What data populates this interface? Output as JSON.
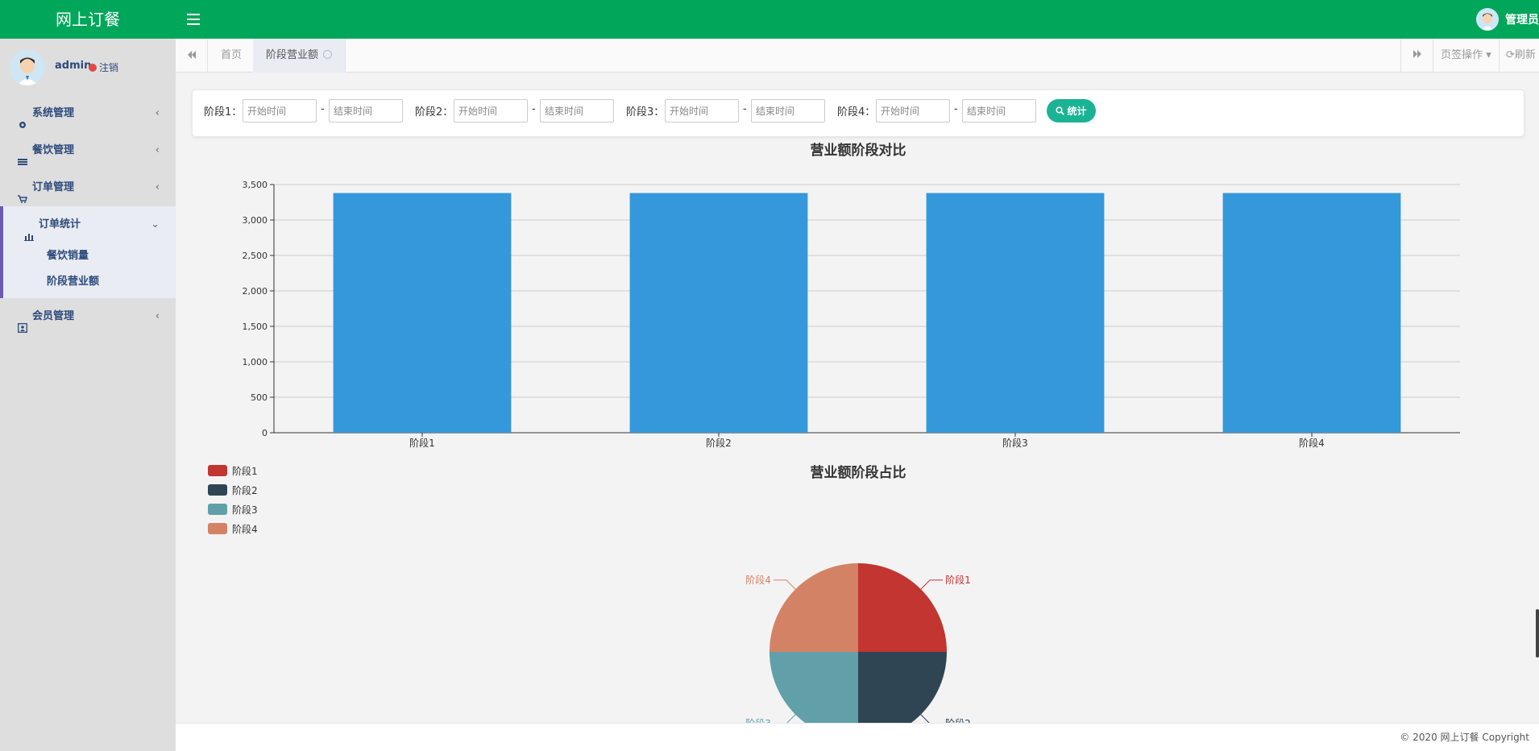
{
  "app": {
    "title": "网上订餐",
    "admin_label": "管理员"
  },
  "user": {
    "name": "admin",
    "logout": "注销"
  },
  "sidebar": {
    "items": [
      {
        "label": "系统管理",
        "icon": "gear-icon"
      },
      {
        "label": "餐饮管理",
        "icon": "list-icon"
      },
      {
        "label": "订单管理",
        "icon": "cart-icon"
      },
      {
        "label": "订单统计",
        "icon": "bar-chart-icon",
        "expanded": true,
        "children": [
          {
            "label": "餐饮销量"
          },
          {
            "label": "阶段营业额"
          }
        ]
      },
      {
        "label": "会员管理",
        "icon": "member-icon"
      }
    ]
  },
  "tabs": [
    {
      "label": "首页"
    },
    {
      "label": "阶段营业额",
      "active": true
    }
  ],
  "tab_actions": {
    "page_ops": "页签操作",
    "refresh": "刷新"
  },
  "filter": {
    "stages": [
      {
        "label": "阶段1：",
        "start_placeholder": "开始时间",
        "end_placeholder": "结束时间"
      },
      {
        "label": "阶段2：",
        "start_placeholder": "开始时间",
        "end_placeholder": "结束时间"
      },
      {
        "label": "阶段3：",
        "start_placeholder": "开始时间",
        "end_placeholder": "结束时间"
      },
      {
        "label": "阶段4：",
        "start_placeholder": "开始时间",
        "end_placeholder": "结束时间"
      }
    ],
    "dash": "-",
    "button": "统计"
  },
  "chart_data": [
    {
      "type": "bar",
      "title": "营业额阶段对比",
      "categories": [
        "阶段1",
        "阶段2",
        "阶段3",
        "阶段4"
      ],
      "values": [
        3380,
        3380,
        3380,
        3380
      ],
      "ylim": [
        0,
        3500
      ],
      "yticks": [
        0,
        500,
        1000,
        1500,
        2000,
        2500,
        3000,
        3500
      ],
      "ytick_labels": [
        "0",
        "500",
        "1,000",
        "1,500",
        "2,000",
        "2,500",
        "3,000",
        "3,500"
      ],
      "grid": true,
      "color": "#3498db"
    },
    {
      "type": "pie",
      "title": "营业额阶段占比",
      "categories": [
        "阶段1",
        "阶段2",
        "阶段3",
        "阶段4"
      ],
      "values": [
        3380,
        3380,
        3380,
        3380
      ],
      "colors": [
        "#c23531",
        "#2f4554",
        "#61a0a8",
        "#d48265"
      ],
      "legend": "top-left"
    }
  ],
  "footer": {
    "copyright": "© 2020 网上订餐 Copyright"
  }
}
